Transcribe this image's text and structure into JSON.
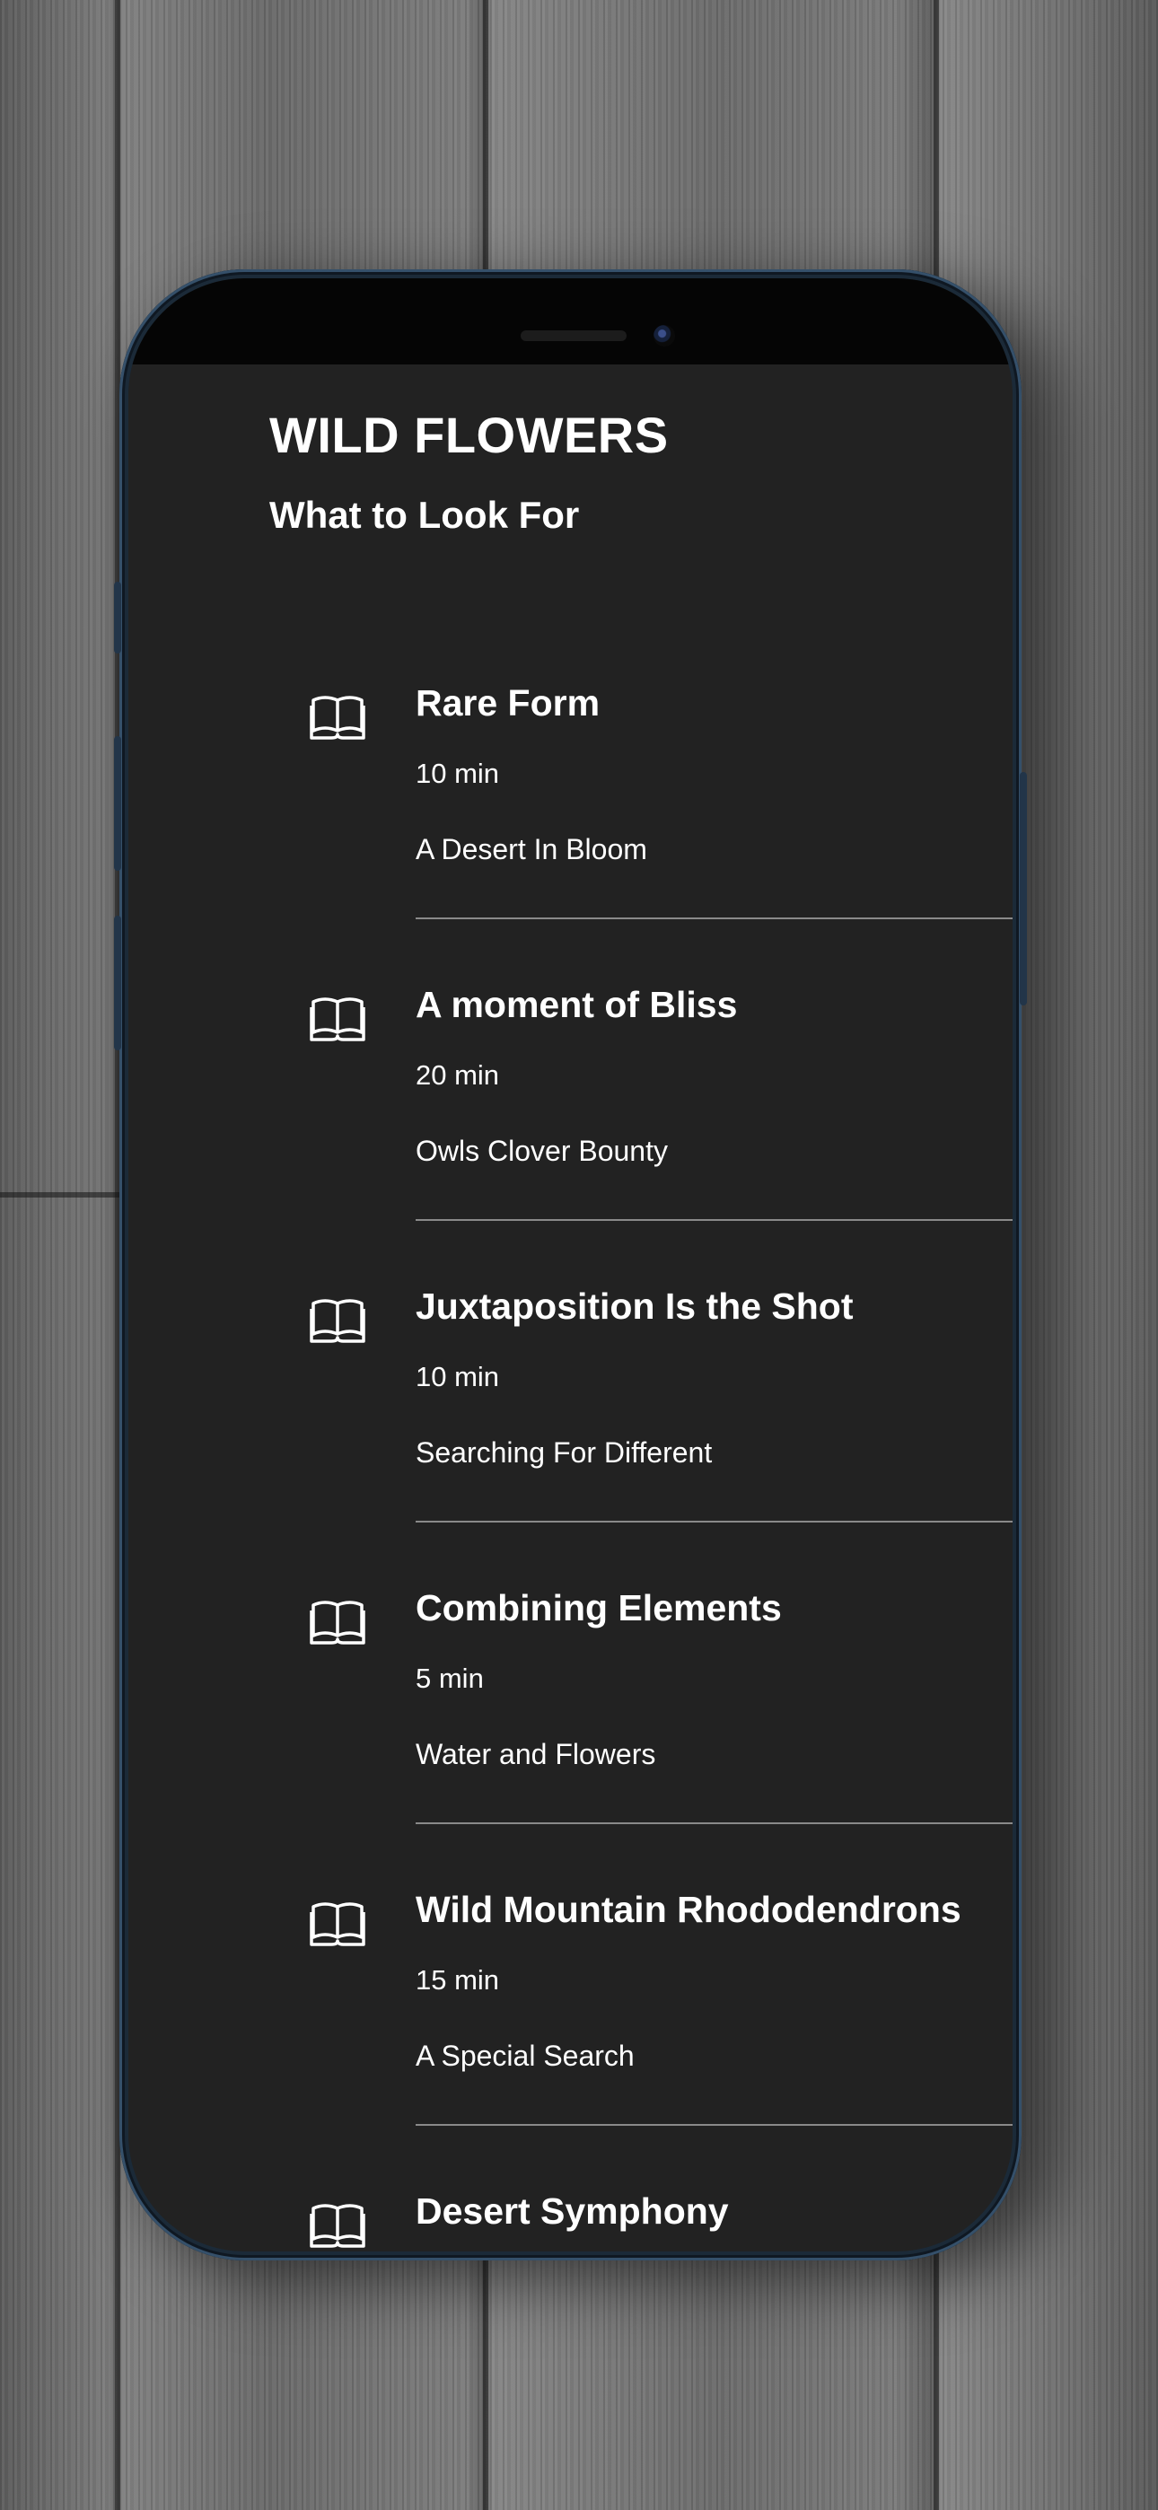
{
  "app": {
    "title": "WILD FLOWERS",
    "subtitle": "What to Look For"
  },
  "items": [
    {
      "title": "Rare Form",
      "duration": "10 min",
      "description": "A Desert In Bloom",
      "icon": "book-icon"
    },
    {
      "title": "A moment of Bliss",
      "duration": "20 min",
      "description": "Owls Clover Bounty",
      "icon": "book-icon"
    },
    {
      "title": "Juxtaposition Is the Shot",
      "duration": "10 min",
      "description": "Searching For Different",
      "icon": "book-icon"
    },
    {
      "title": "Combining Elements",
      "duration": "5 min",
      "description": "Water and Flowers",
      "icon": "book-icon"
    },
    {
      "title": "Wild Mountain Rhododendrons",
      "duration": "15 min",
      "description": "A Special Search",
      "icon": "book-icon"
    },
    {
      "title": "Desert Symphony",
      "icon": "book-icon"
    }
  ],
  "colors": {
    "screen_background": "#222222",
    "text": "#ffffff",
    "divider": "#8a8a8a",
    "phone_frame": "#1b2a38",
    "wood_background": "#6e6e6e"
  }
}
